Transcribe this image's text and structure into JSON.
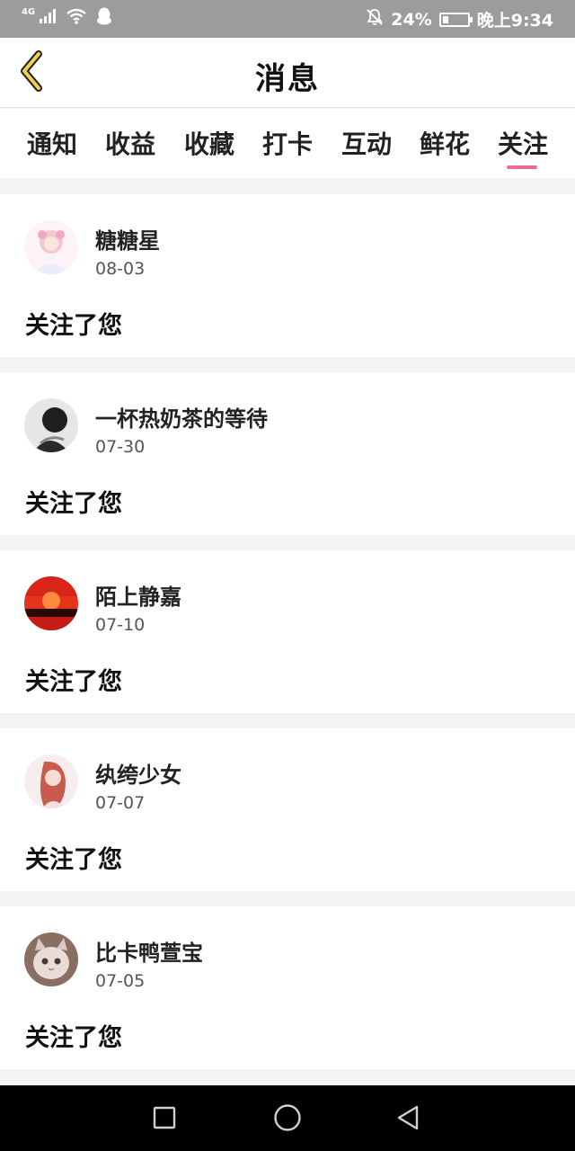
{
  "status_bar": {
    "network": "4G",
    "signal_icon": "signal-icon",
    "wifi_icon": "wifi-icon",
    "app_icon": "qq-penguin-icon",
    "mute_icon": "bell-off-icon",
    "battery_percent_label": "24%",
    "battery_level": 0.24,
    "time": "晚上9:34"
  },
  "header": {
    "back_icon": "chevron-left-icon",
    "title": "消息"
  },
  "tabs": {
    "items": [
      {
        "label": "通知"
      },
      {
        "label": "收益"
      },
      {
        "label": "收藏"
      },
      {
        "label": "打卡"
      },
      {
        "label": "互动"
      },
      {
        "label": "鲜花"
      },
      {
        "label": "关注"
      }
    ],
    "active": "关注",
    "accent_color": "#e86c9f"
  },
  "notifications": [
    {
      "username": "糖糖星",
      "date": "08-03",
      "action": "关注了您"
    },
    {
      "username": "一杯热奶茶的等待",
      "date": "07-30",
      "action": "关注了您"
    },
    {
      "username": "陌上静嘉",
      "date": "07-10",
      "action": "关注了您"
    },
    {
      "username": "纨绔少女",
      "date": "07-07",
      "action": "关注了您"
    },
    {
      "username": "比卡鸭萱宝",
      "date": "07-05",
      "action": "关注了您"
    }
  ],
  "nav_bar": {
    "recents_icon": "square-recents-icon",
    "home_icon": "circle-home-icon",
    "back_icon": "triangle-back-icon"
  }
}
